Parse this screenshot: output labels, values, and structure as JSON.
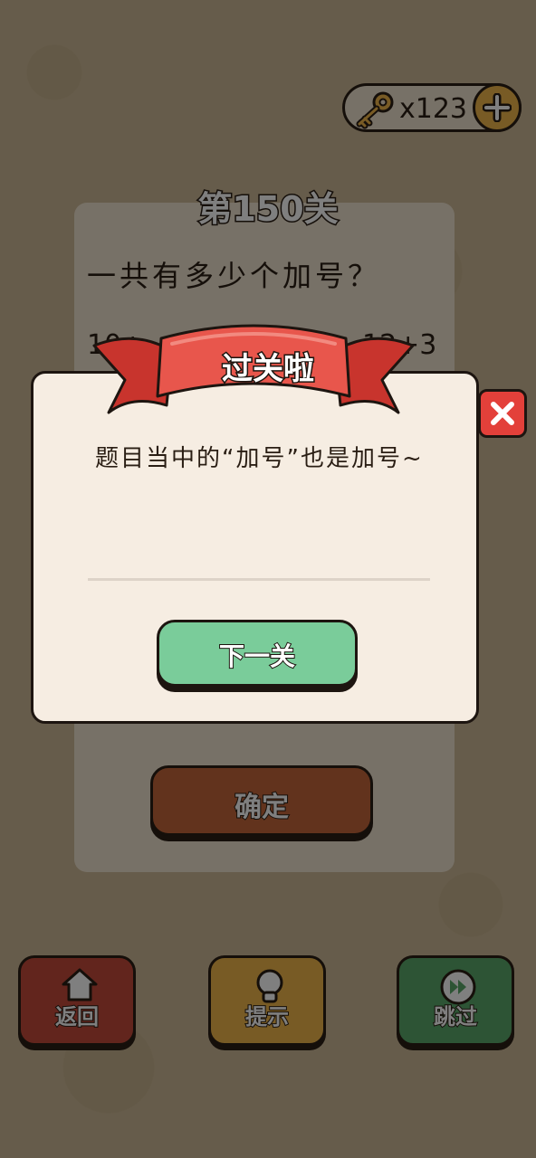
{
  "header": {
    "key_count": "x123"
  },
  "level": {
    "title": "第150关",
    "question": "一共有多少个加号？",
    "expression_left": "10+",
    "expression_right": "12+3",
    "confirm_label": "确定"
  },
  "bottom_bar": {
    "back_label": "返回",
    "hint_label": "提示",
    "skip_label": "跳过"
  },
  "popup": {
    "ribbon_title": "过关啦",
    "message": "题目当中的“加号”也是加号~",
    "next_label": "下一关"
  },
  "colors": {
    "background": "#cdb996",
    "popup_bg": "#f6ede2",
    "ribbon_red": "#d9453c",
    "next_green": "#7acc9a",
    "close_red": "#e3403a",
    "back_red": "#c44a3a",
    "hint_yellow": "#f0b64a",
    "skip_green": "#5aa96a"
  },
  "icons": [
    "key-icon",
    "plus-icon",
    "home-icon",
    "lightbulb-icon",
    "fast-forward-icon",
    "close-icon"
  ]
}
